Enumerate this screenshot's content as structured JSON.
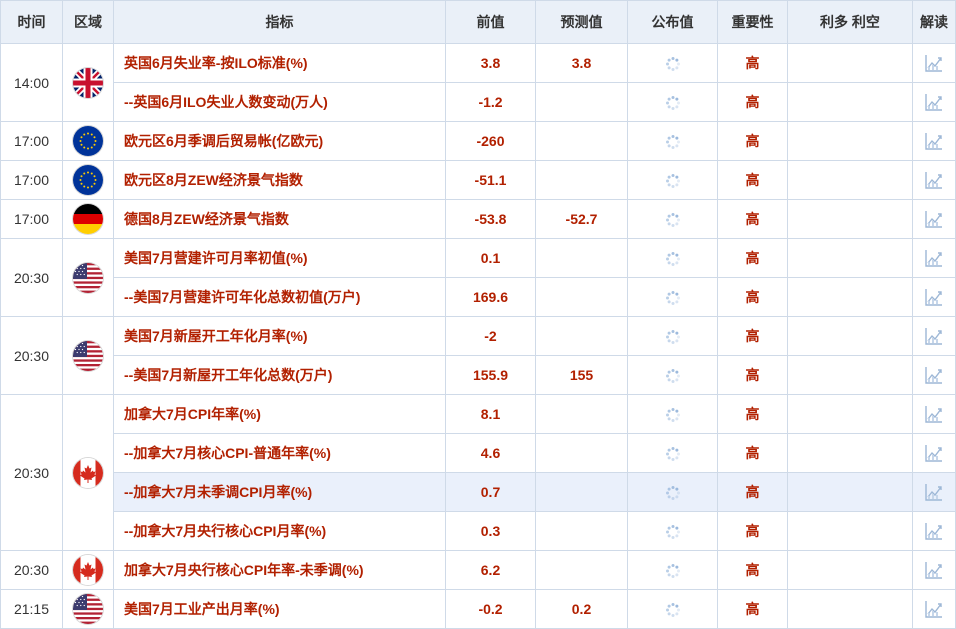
{
  "header": {
    "time": "时间",
    "region": "区域",
    "indicator": "指标",
    "previous": "前值",
    "forecast": "预测值",
    "actual": "公布值",
    "importance": "重要性",
    "impact": "利多 利空",
    "analysis": "解读"
  },
  "icons": {
    "loading": "loading-spinner-icon",
    "chart": "chart-analysis-icon"
  },
  "colors": {
    "header_bg": "#eaf0f8",
    "border": "#cfdae8",
    "text_red": "#b22000",
    "highlight_row": "#eaf0fb"
  },
  "groups": [
    {
      "time": "14:00",
      "flag": "uk",
      "events": [
        {
          "name": "英国6月失业率-按ILO标准(%)",
          "previous": "3.8",
          "forecast": "3.8",
          "importance": "高"
        },
        {
          "name": "--英国6月ILO失业人数变动(万人)",
          "previous": "-1.2",
          "forecast": "",
          "importance": "高"
        }
      ]
    },
    {
      "time": "17:00",
      "flag": "eu",
      "events": [
        {
          "name": "欧元区6月季调后贸易帐(亿欧元)",
          "previous": "-260",
          "forecast": "",
          "importance": "高"
        }
      ]
    },
    {
      "time": "17:00",
      "flag": "eu",
      "events": [
        {
          "name": "欧元区8月ZEW经济景气指数",
          "previous": "-51.1",
          "forecast": "",
          "importance": "高"
        }
      ]
    },
    {
      "time": "17:00",
      "flag": "de",
      "events": [
        {
          "name": "德国8月ZEW经济景气指数",
          "previous": "-53.8",
          "forecast": "-52.7",
          "importance": "高"
        }
      ]
    },
    {
      "time": "20:30",
      "flag": "us",
      "events": [
        {
          "name": "美国7月营建许可月率初值(%)",
          "previous": "0.1",
          "forecast": "",
          "importance": "高"
        },
        {
          "name": "--美国7月营建许可年化总数初值(万户)",
          "previous": "169.6",
          "forecast": "",
          "importance": "高"
        }
      ]
    },
    {
      "time": "20:30",
      "flag": "us",
      "events": [
        {
          "name": "美国7月新屋开工年化月率(%)",
          "previous": "-2",
          "forecast": "",
          "importance": "高"
        },
        {
          "name": "--美国7月新屋开工年化总数(万户)",
          "previous": "155.9",
          "forecast": "155",
          "importance": "高"
        }
      ]
    },
    {
      "time": "20:30",
      "flag": "ca",
      "events": [
        {
          "name": "加拿大7月CPI年率(%)",
          "previous": "8.1",
          "forecast": "",
          "importance": "高"
        },
        {
          "name": "--加拿大7月核心CPI-普通年率(%)",
          "previous": "4.6",
          "forecast": "",
          "importance": "高"
        },
        {
          "name": "--加拿大7月未季调CPI月率(%)",
          "previous": "0.7",
          "forecast": "",
          "importance": "高",
          "highlight": true
        },
        {
          "name": "--加拿大7月央行核心CPI月率(%)",
          "previous": "0.3",
          "forecast": "",
          "importance": "高"
        }
      ]
    },
    {
      "time": "20:30",
      "flag": "ca",
      "events": [
        {
          "name": "加拿大7月央行核心CPI年率-未季调(%)",
          "previous": "6.2",
          "forecast": "",
          "importance": "高"
        }
      ]
    },
    {
      "time": "21:15",
      "flag": "us",
      "events": [
        {
          "name": "美国7月工业产出月率(%)",
          "previous": "-0.2",
          "forecast": "0.2",
          "importance": "高"
        }
      ]
    }
  ]
}
